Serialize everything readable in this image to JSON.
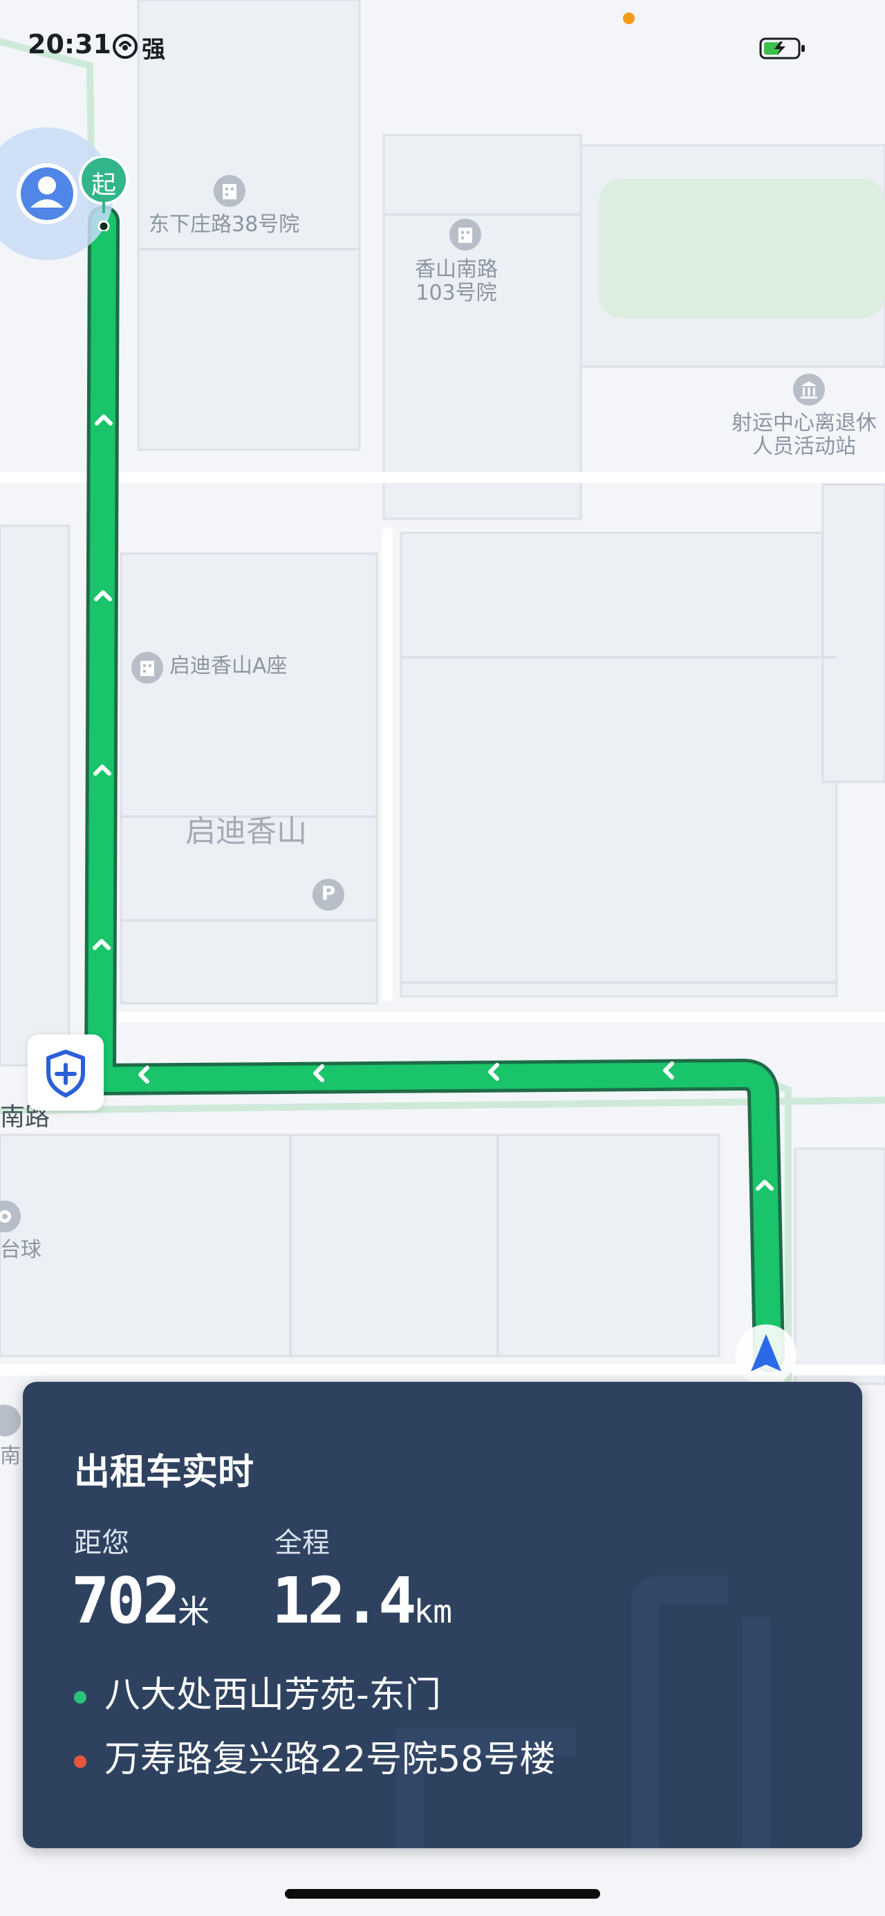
{
  "status_bar": {
    "time": "20:31",
    "signal_label": "强",
    "icons": [
      "signal-icon",
      "battery-charging-icon"
    ],
    "dot_color": "#f59b1a"
  },
  "map": {
    "pois": [
      {
        "name": "东下庄路38号院",
        "icon": "building-icon"
      },
      {
        "name": "香山南路\n103号院",
        "icon": "building-icon"
      },
      {
        "name": "射运中心离退休\n人员活动站",
        "icon": "museum-icon"
      },
      {
        "name": "启迪香山A座",
        "icon": "building-icon"
      },
      {
        "name": "台球",
        "icon": "billiards-icon"
      },
      {
        "name": "P",
        "icon": "parking-icon"
      }
    ],
    "area_label": "启迪香山",
    "road_label": "南路",
    "partial_label": "南",
    "start_marker_label": "起",
    "route_color": "#19c46a"
  },
  "taxi_card": {
    "title": "出租车实时",
    "distance_to_you_label": "距您",
    "distance_to_you_value": "702",
    "distance_to_you_unit": "米",
    "total_label": "全程",
    "total_value": "12.4",
    "total_unit": "km",
    "origin": "八大处西山芳苑-东门",
    "destination": "万寿路复兴路22号院58号楼",
    "origin_dot_color": "#2bc07c",
    "destination_dot_color": "#e9573f",
    "background": "#2e4260"
  }
}
